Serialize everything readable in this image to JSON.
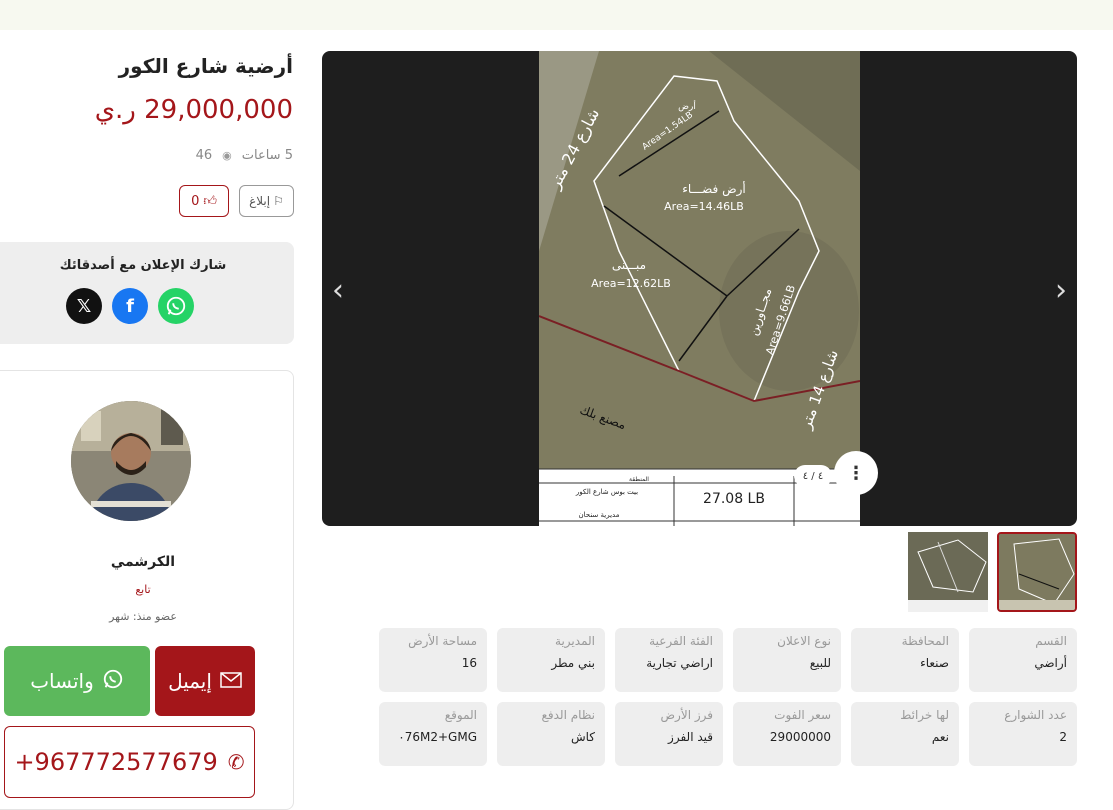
{
  "listing": {
    "title": "أرضية شارع الكور",
    "price": "29,000,000 ر.ي",
    "time_ago": "5 ساعات",
    "views": "46",
    "likes": "0",
    "report_label": "إبلاغ"
  },
  "share": {
    "title": "شارك الإعلان مع أصدقائك",
    "icons": [
      "whatsapp-icon",
      "facebook-icon",
      "x-icon"
    ]
  },
  "seller": {
    "name": "الكرشمي",
    "role": "تابع",
    "member_since": "عضو منذ: شهر"
  },
  "contact": {
    "email_label": "إيميل",
    "whatsapp_label": "واتساب",
    "phone": "+967772577679"
  },
  "gallery": {
    "counter": "٤ / ٤",
    "map_labels": {
      "street24": "شارع 24 متر",
      "street14": "شارع 14 متر",
      "empty_land": "أرض فضـــاء",
      "empty_area": "Area=14.46LB",
      "building": "مبـــنى",
      "building_area": "Area=12.62LB",
      "neighbors": "مجــاورين",
      "neighbors_area": "Area=9.66LB",
      "small_land": "أرض",
      "small_area": "Area=1.54LB",
      "factory": "مصنع بلك",
      "total": "27.08 LB",
      "table_region": "المنطقة",
      "table_street": "بيت بوس شارع الكور",
      "table_district": "مديرية سنحان"
    }
  },
  "details": [
    {
      "label": "القسم",
      "value": "أراضي"
    },
    {
      "label": "المحافظة",
      "value": "صنعاء"
    },
    {
      "label": "نوع الاعلان",
      "value": "للبيع"
    },
    {
      "label": "الفئة الفرعية",
      "value": "اراضي تجارية"
    },
    {
      "label": "المديرية",
      "value": "بني مطر"
    },
    {
      "label": "مساحة الأرض",
      "value": "16"
    },
    {
      "label": "عدد الشوارع",
      "value": "2"
    },
    {
      "label": "لها خرائط",
      "value": "نعم"
    },
    {
      "label": "سعر الفوت",
      "value": "29000000"
    },
    {
      "label": "فرز الأرض",
      "value": "قيد الفرز"
    },
    {
      "label": "نظام الدفع",
      "value": "كاش"
    },
    {
      "label": "الموقع",
      "value": "٠76M2+GMG"
    }
  ],
  "colors": {
    "accent": "#a4161a",
    "whatsapp": "#5cb85c",
    "panel": "#eeeeee"
  }
}
